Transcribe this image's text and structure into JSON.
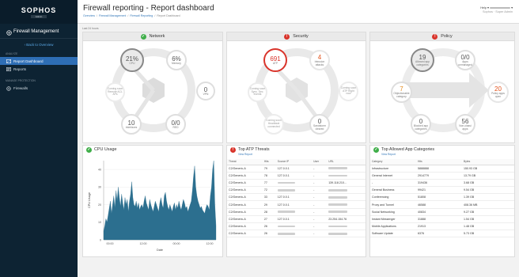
{
  "brand": {
    "logo": "SOPHOS",
    "sub": "Admin"
  },
  "sidebar": {
    "title": "Firewall Management",
    "back": "Back to Overview",
    "sections": [
      {
        "label": "ANALYZE",
        "items": [
          {
            "label": "Report Dashboard",
            "active": true
          },
          {
            "label": "Reports",
            "active": false
          }
        ]
      },
      {
        "label": "MANAGE PROTECTION",
        "items": [
          {
            "label": "Firewalls",
            "active": false
          }
        ]
      }
    ]
  },
  "header": {
    "title": "Firewall reporting - Report dashboard",
    "crumbs": [
      "Overview",
      "Firewall Management",
      "Firewall Reporting",
      "Report Dashboard"
    ],
    "help": "Help ▾",
    "user_role": "Sophos · Super Admin"
  },
  "range_label": "Last 24 hours",
  "panels": {
    "network": {
      "title": "Network",
      "status": "ok",
      "circles": [
        {
          "id": "cpu",
          "value": "21%",
          "label": "CPU"
        },
        {
          "id": "memory",
          "value": "6%",
          "label": "Memory"
        },
        {
          "id": "vpn",
          "value": "0",
          "label": "VPN"
        },
        {
          "id": "red",
          "value": "0/0",
          "label": "RED"
        },
        {
          "id": "interfaces",
          "value": "10",
          "label": "Interfaces"
        },
        {
          "id": "soon1",
          "value": "",
          "label": "Coming soon Remote ACL APs"
        }
      ]
    },
    "security": {
      "title": "Security",
      "status": "alert",
      "circles": [
        {
          "id": "atp",
          "value": "691",
          "label": "ATP"
        },
        {
          "id": "intrusion",
          "value": "4",
          "label": "Intrusion attacks"
        },
        {
          "id": "sandbox",
          "value": "0",
          "label": "Sandstorm cleared"
        },
        {
          "id": "soon1",
          "value": "",
          "label": "Coming soon Sync. Sec. events"
        },
        {
          "id": "soon2",
          "value": "",
          "label": "Coming soon ATP Right now"
        },
        {
          "id": "soon3",
          "value": "",
          "label": "Coming soon Heartbeat connected"
        }
      ]
    },
    "policy": {
      "title": "Policy",
      "status": "alert",
      "circles": [
        {
          "id": "allowed_app",
          "value": "19",
          "label": "Allowed app categories"
        },
        {
          "id": "apps_unmanaged",
          "value": "0/0",
          "label": "Apps unmanaged"
        },
        {
          "id": "objectionable",
          "value": "7",
          "label": "Objectionable category"
        },
        {
          "id": "policy_apps",
          "value": "20",
          "label": "Policy apps open"
        },
        {
          "id": "blocked_app",
          "value": "0",
          "label": "Blocked app categories"
        },
        {
          "id": "nonclassified",
          "value": "56",
          "label": "Non-classi apps"
        }
      ]
    }
  },
  "cpu_usage": {
    "title": "CPU Usage",
    "chart_data": {
      "type": "area",
      "title": "",
      "xlabel": "Date",
      "ylabel": "CPU Usage",
      "ylim": [
        0,
        45
      ],
      "yticks": [
        0,
        10,
        20,
        30,
        40
      ],
      "xtick_labels": [
        "00:00",
        "12:00",
        "00:00",
        "12:00"
      ],
      "color": "#2c6f8f",
      "series": [
        {
          "values": [
            5,
            8,
            12,
            10,
            14,
            18,
            22,
            15,
            20,
            25,
            18,
            28,
            22,
            30,
            24,
            19,
            26,
            21,
            17,
            24,
            20,
            23,
            16,
            22,
            26,
            33,
            24,
            20,
            19,
            22,
            18,
            21,
            17,
            19,
            20,
            18,
            22,
            25,
            21,
            19,
            17,
            23,
            20,
            18,
            16,
            19,
            22,
            20,
            18,
            16,
            21,
            24,
            20,
            18,
            25,
            27,
            22,
            19,
            17,
            20,
            18,
            16,
            19,
            21,
            17,
            20,
            18,
            22,
            19,
            17,
            20,
            23,
            21,
            18,
            19,
            16,
            18,
            20,
            22,
            28,
            36,
            42,
            30,
            25,
            22,
            20,
            18,
            19,
            17,
            16,
            15,
            18,
            20,
            19,
            17,
            25,
            30,
            40,
            45,
            20,
            8
          ]
        }
      ]
    }
  },
  "atp_threats": {
    "title": "Top ATP Threats",
    "view_report": "View Report",
    "columns": [
      "Threat",
      "Hits",
      "Source IP",
      "User",
      "URL"
    ],
    "rows": [
      {
        "threat": "C2/Generic-A",
        "hits": "79",
        "ip": "127.0.0.1",
        "user": "-"
      },
      {
        "threat": "C2/Generic-A",
        "hits": "78",
        "ip": "127.0.0.1",
        "user": "-"
      },
      {
        "threat": "C2/Generic-A",
        "hits": "77",
        "ip": "",
        "user": "-",
        "url": "139.118.210..."
      },
      {
        "threat": "C2/Generic-A",
        "hits": "72",
        "ip": "",
        "user": "-"
      },
      {
        "threat": "C2/Generic-A",
        "hits": "33",
        "ip": "127.0.0.1",
        "user": "-"
      },
      {
        "threat": "C2/Generic-A",
        "hits": "29",
        "ip": "127.0.0.1",
        "user": "-"
      },
      {
        "threat": "C2/Generic-A",
        "hits": "28",
        "ip": "",
        "user": "-"
      },
      {
        "threat": "C2/Generic-A",
        "hits": "27",
        "ip": "127.0.0.1",
        "user": "-",
        "url": "23.254.154.76"
      },
      {
        "threat": "C2/Generic-A",
        "hits": "26",
        "ip": "",
        "user": "-"
      },
      {
        "threat": "C2/Generic-A",
        "hits": "26",
        "ip": "",
        "user": "-"
      }
    ]
  },
  "app_categories": {
    "title": "Top Allowed App Categories",
    "view_report": "View Report",
    "columns": [
      "Category",
      "Hits",
      "Bytes"
    ],
    "rows": [
      {
        "category": "Infrastructure",
        "hits": "5888888",
        "bytes": "150.93 GB"
      },
      {
        "category": "General Internet",
        "hits": "2914779",
        "bytes": "13.79 GB"
      },
      {
        "category": "-",
        "hits": "319436",
        "bytes": "3.68 GB"
      },
      {
        "category": "General Business",
        "hits": "99421",
        "bytes": "9.54 GB"
      },
      {
        "category": "Conferencing",
        "hits": "51808",
        "bytes": "1.39 GB"
      },
      {
        "category": "Proxy and Tunnel",
        "hits": "46588",
        "bytes": "408.36 MB"
      },
      {
        "category": "Social Networking",
        "hits": "40834",
        "bytes": "9.27 GB"
      },
      {
        "category": "Instant Messenger",
        "hits": "31888",
        "bytes": "1.54 GB"
      },
      {
        "category": "Mobile Applications",
        "hits": "21913",
        "bytes": "1.48 GB"
      },
      {
        "category": "Software Update",
        "hits": "6376",
        "bytes": "5.73 GB"
      }
    ]
  }
}
